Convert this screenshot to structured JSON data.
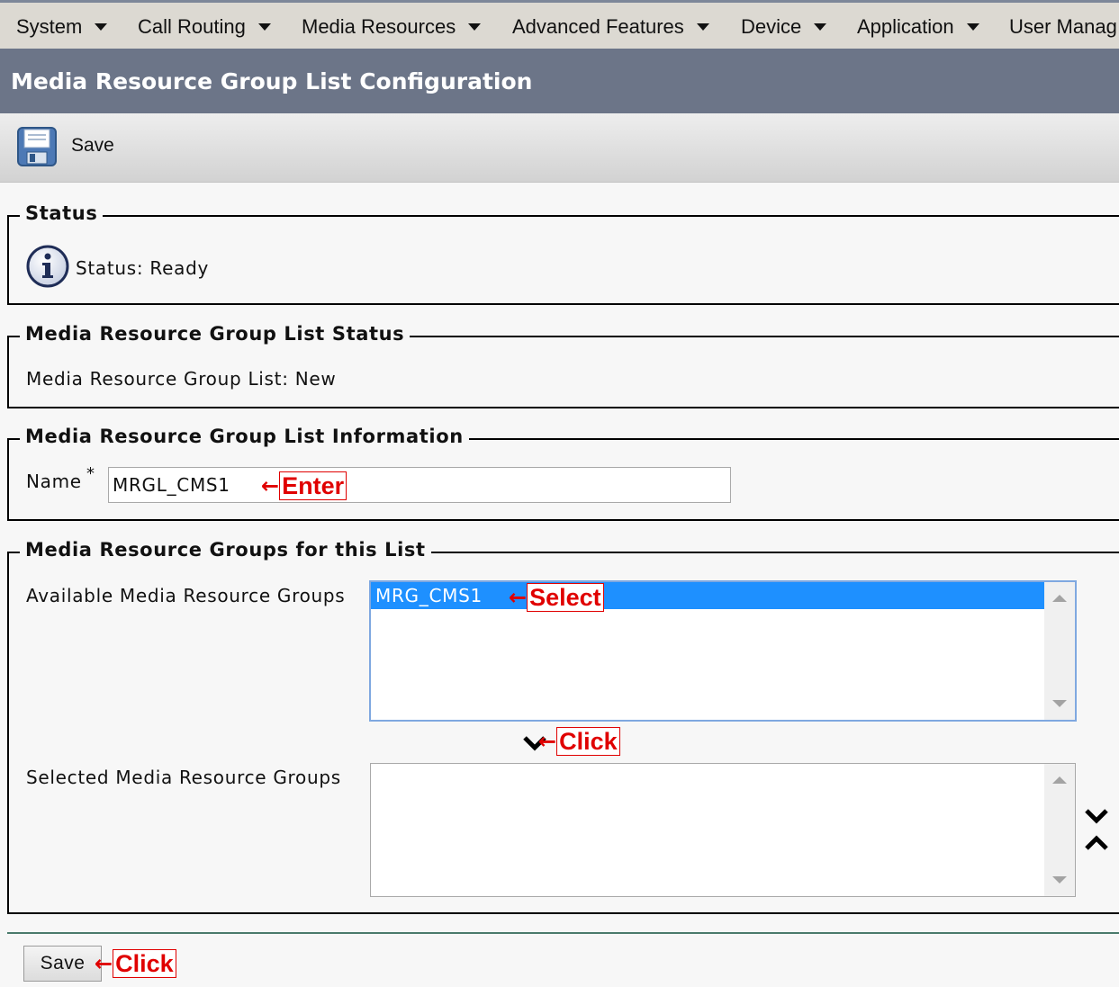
{
  "menu": {
    "items": [
      {
        "label": "System"
      },
      {
        "label": "Call Routing"
      },
      {
        "label": "Media Resources"
      },
      {
        "label": "Advanced Features"
      },
      {
        "label": "Device"
      },
      {
        "label": "Application"
      },
      {
        "label": "User Manag"
      }
    ]
  },
  "page": {
    "title": "Media Resource Group List Configuration"
  },
  "toolbar": {
    "save_label": "Save",
    "save_icon": "floppy-disk-icon"
  },
  "status_section": {
    "legend": "Status",
    "icon": "info-icon",
    "text": "Status: Ready"
  },
  "mrgl_status_section": {
    "legend": "Media Resource Group List Status",
    "text": "Media Resource Group List: New"
  },
  "info_section": {
    "legend": "Media Resource Group List Information",
    "name_label": "Name",
    "required_mark": "*",
    "name_value": "MRGL_CMS1"
  },
  "groups_section": {
    "legend": "Media Resource Groups for this List",
    "available_label": "Available Media Resource Groups",
    "available_options": [
      "MRG_CMS1"
    ],
    "selected_label": "Selected Media Resource Groups",
    "selected_options": []
  },
  "annotations": {
    "arrow": "←",
    "enter": "Enter",
    "select": "Select",
    "click_move": "Click",
    "click_save": "Click"
  },
  "bottom": {
    "save_label": "Save"
  },
  "colors": {
    "menubar": "#dcd9d2",
    "titlebar": "#6c7588",
    "selection": "#1e90ff",
    "annotation": "#e00000"
  }
}
